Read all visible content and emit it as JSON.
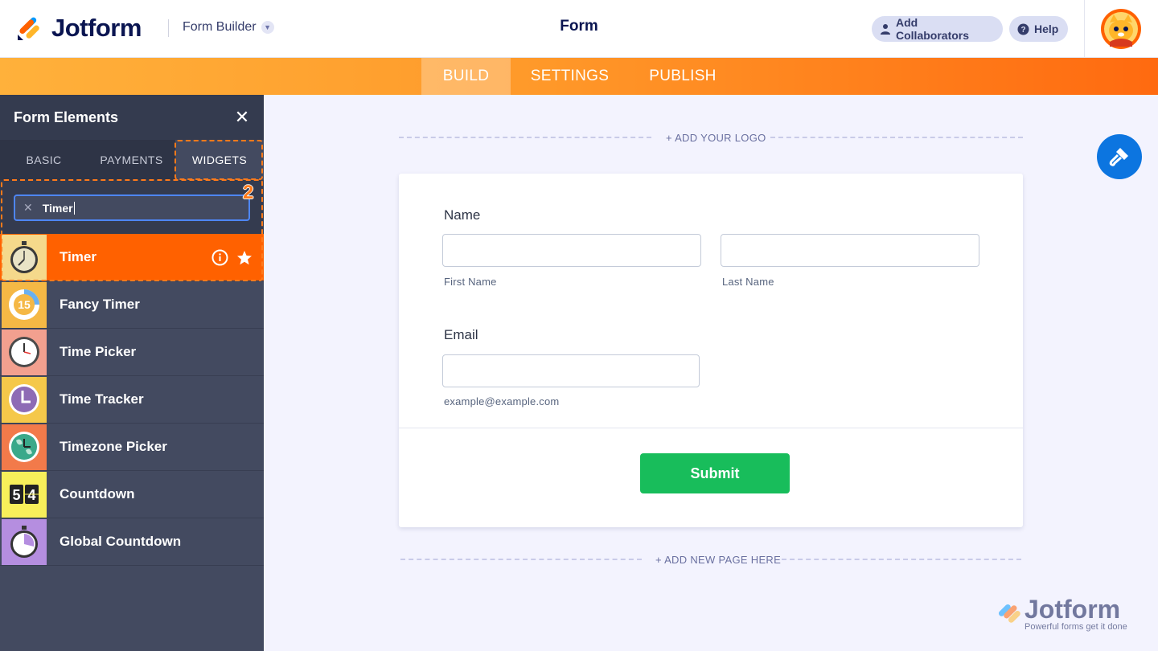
{
  "header": {
    "brand": "Jotform",
    "builder_menu": "Form Builder",
    "title": "Form",
    "add_collaborators": "Add Collaborators",
    "help": "Help"
  },
  "nav": {
    "tabs": [
      {
        "label": "BUILD",
        "active": true
      },
      {
        "label": "SETTINGS",
        "active": false
      },
      {
        "label": "PUBLISH",
        "active": false
      }
    ]
  },
  "sidebar": {
    "title": "Form Elements",
    "tabs": [
      {
        "label": "BASIC"
      },
      {
        "label": "PAYMENTS"
      },
      {
        "label": "WIDGETS",
        "active": true
      }
    ],
    "search_value": "Timer",
    "annotation_number": "2",
    "widgets": [
      {
        "label": "Timer",
        "icon": "stopwatch-icon",
        "selected": true
      },
      {
        "label": "Fancy Timer",
        "icon": "fancy-timer-icon"
      },
      {
        "label": "Time Picker",
        "icon": "clock-icon"
      },
      {
        "label": "Time Tracker",
        "icon": "time-tracker-icon"
      },
      {
        "label": "Timezone Picker",
        "icon": "globe-clock-icon"
      },
      {
        "label": "Countdown",
        "icon": "flip-counter-icon"
      },
      {
        "label": "Global Countdown",
        "icon": "stopwatch-purple-icon"
      }
    ]
  },
  "canvas": {
    "add_logo": "+ ADD YOUR LOGO",
    "add_page": "+ ADD NEW PAGE HERE"
  },
  "form": {
    "name_label": "Name",
    "first_name_sub": "First Name",
    "last_name_sub": "Last Name",
    "email_label": "Email",
    "email_sub": "example@example.com",
    "submit_label": "Submit"
  },
  "watermark": {
    "brand": "Jotform",
    "tagline": "Powerful forms get it done"
  },
  "colors": {
    "accent_orange": "#ff6100",
    "sidebar_bg": "#434a60",
    "submit_green": "#18bd5b",
    "paint_blue": "#0c75e0",
    "search_border": "#4e86f5"
  }
}
